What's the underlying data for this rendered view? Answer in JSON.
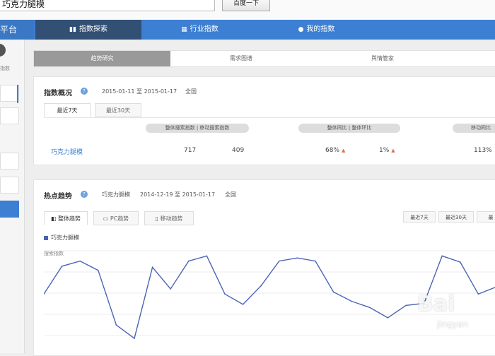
{
  "search": {
    "value": "巧克力腿模",
    "button_label": "百度一下"
  },
  "nav": {
    "brand": "平台",
    "tabs": [
      {
        "label": "指数探索",
        "icon": "bar-chart-icon",
        "active": true
      },
      {
        "label": "行业指数",
        "icon": "building-icon",
        "active": false
      },
      {
        "label": "我的指数",
        "icon": "user-icon",
        "active": false
      }
    ]
  },
  "sidebar": {
    "label": "指数"
  },
  "subtabs": [
    {
      "label": "趋势研究",
      "active": true
    },
    {
      "label": "需求图谱",
      "active": false
    },
    {
      "label": "舆情管家",
      "active": false
    }
  ],
  "overview": {
    "title": "指数概况",
    "date_range": "2015-01-11 至 2015-01-17",
    "region": "全国",
    "time_tabs": [
      "最近7天",
      "最近30天"
    ],
    "headers": {
      "search_index": "整体搜索指数 | 移动搜索指数",
      "yoy": "整体同比 | 整体环比",
      "mobile_yoy": "移动同比"
    },
    "row": {
      "keyword": "巧克力腿模",
      "overall": "717",
      "mobile": "409",
      "yoy": "68%",
      "mom": "1%",
      "mobile_pct": "113%"
    }
  },
  "trend": {
    "title": "热点趋势",
    "keyword": "巧克力腿模",
    "date_range": "2014-12-19 至 2015-01-17",
    "region": "全国",
    "tabs": [
      "整体趋势",
      "PC趋势",
      "移动趋势"
    ],
    "ranges": [
      "最近7天",
      "最近30天",
      "最"
    ],
    "legend": "巧克力腿模",
    "y_title": "搜索指数",
    "line_color": "#4b63b5"
  },
  "chart_data": {
    "type": "line",
    "series": [
      {
        "name": "巧克力腿模",
        "values": [
          58,
          85,
          90,
          81,
          28,
          15,
          84,
          63,
          90,
          95,
          58,
          48,
          66,
          90,
          93,
          90,
          60,
          51,
          45,
          35,
          47,
          49,
          95,
          89,
          58,
          65
        ]
      }
    ],
    "ylabel": "搜索指数",
    "ylim": [
      0,
      100
    ],
    "grid": true
  },
  "watermark": {
    "brand": "Bai",
    "sub": "jingyan"
  }
}
